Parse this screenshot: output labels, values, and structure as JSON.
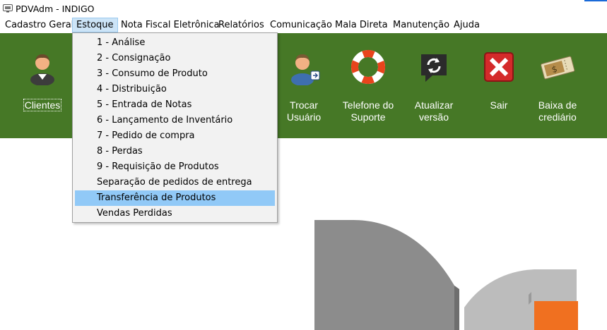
{
  "window": {
    "title": "PDVAdm - INDIGO",
    "icon": "app-monitor-icon"
  },
  "menubar": {
    "items": [
      {
        "label": "Cadastro Geral",
        "active": false
      },
      {
        "label": "Estoque",
        "active": true
      },
      {
        "label": "Nota Fiscal Eletrônica",
        "active": false
      },
      {
        "label": "Relatórios",
        "active": false
      },
      {
        "label": "Comunicação",
        "active": false
      },
      {
        "label": "Mala Direta",
        "active": false
      },
      {
        "label": "Manutenção",
        "active": false
      },
      {
        "label": "Ajuda",
        "active": false
      }
    ]
  },
  "dropdown": {
    "items": [
      {
        "label": "1 - Análise"
      },
      {
        "label": "2 - Consignação"
      },
      {
        "label": "3 - Consumo de Produto"
      },
      {
        "label": "4 - Distribuição"
      },
      {
        "label": "5 - Entrada de Notas"
      },
      {
        "label": "6 - Lançamento de Inventário"
      },
      {
        "label": "7 - Pedido de compra"
      },
      {
        "label": "8 - Perdas"
      },
      {
        "label": "9 - Requisição de Produtos"
      },
      {
        "label": "Separação de pedidos de entrega"
      },
      {
        "label": "Transferência de Produtos",
        "highlighted": true
      },
      {
        "label": "Vendas Perdidas"
      }
    ]
  },
  "toolbar": {
    "background": "#467826",
    "buttons": [
      {
        "label": "Clientes",
        "icon": "user-icon"
      },
      {
        "label": "Trocar\nUsuário",
        "icon": "switch-user-icon"
      },
      {
        "label": "Telefone do\nSuporte",
        "icon": "lifebuoy-icon"
      },
      {
        "label": "Atualizar\nversão",
        "icon": "update-icon"
      },
      {
        "label": "Sair",
        "icon": "exit-icon"
      },
      {
        "label": "Baixa de\ncrediário",
        "icon": "money-ticket-icon"
      }
    ]
  },
  "colors": {
    "menu_highlight": "#91c9f7",
    "active_menu": "#cce4f7",
    "logo_orange": "#f07020",
    "logo_gray": "#8c8c8c"
  }
}
